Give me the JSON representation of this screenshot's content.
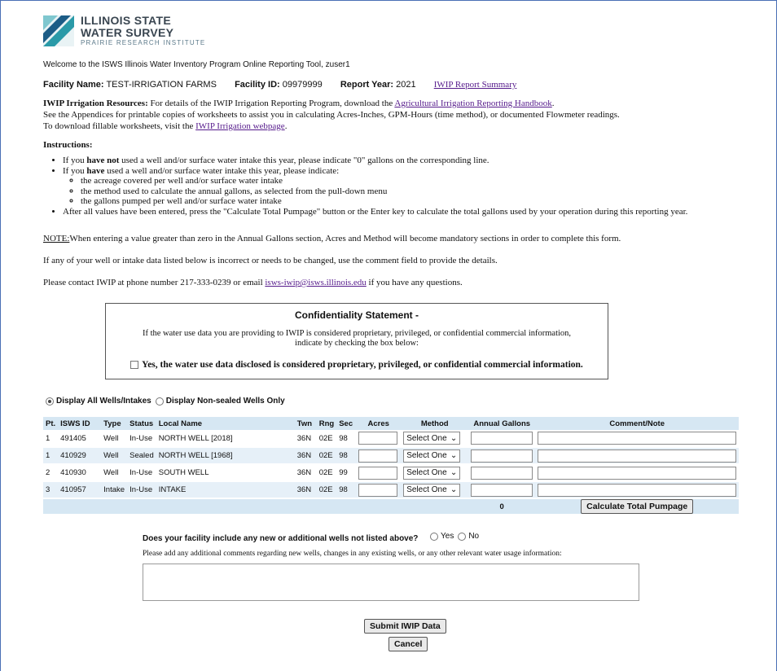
{
  "logo": {
    "line1": "ILLINOIS STATE",
    "line2": "WATER SURVEY",
    "line3": "PRAIRIE RESEARCH INSTITUTE"
  },
  "welcome": "Welcome to the ISWS Illinois Water Inventory Program Online Reporting Tool, zuser1",
  "facility": {
    "name_label": "Facility Name:",
    "name_value": "TEST-IRRIGATION FARMS",
    "id_label": "Facility ID:",
    "id_value": "09979999",
    "year_label": "Report Year:",
    "year_value": "2021",
    "summary_link": "IWIP Report Summary"
  },
  "resources": {
    "label": "IWIP Irrigation Resources:",
    "line1_text": " For details of the IWIP Irrigation Reporting Program, download the ",
    "handbook_link": "Agricultural Irrigation Reporting Handbook",
    "line1_end": ".",
    "line2": "See the Appendices for printable copies of worksheets to assist you in calculating Acres-Inches, GPM-Hours (time method), or documented Flowmeter readings.",
    "line3_text": "To download fillable worksheets, visit the ",
    "webpage_link": "IWIP Irrigation webpage",
    "line3_end": "."
  },
  "instructions": {
    "heading": "Instructions:",
    "b1_pre": "If you ",
    "b1_bold": "have not",
    "b1_post": " used a well and/or surface water intake this year, please indicate \"0\" gallons on the corresponding line.",
    "b2_pre": "If you ",
    "b2_bold": "have",
    "b2_post": " used a well and/or surface water intake this year, please indicate:",
    "sub1": "the acreage covered per well and/or surface water intake",
    "sub2": "the method used to calculate the annual gallons, as selected from the pull-down menu",
    "sub3": "the gallons pumped per well and/or surface water intake",
    "b3": "After all values have been entered, press the \"Calculate Total Pumpage\" button or the Enter key to calculate the total gallons used by your operation during this reporting year."
  },
  "note": {
    "label": "NOTE:",
    "text": "When entering a value greater than zero in the Annual Gallons section, Acres and Method will become mandatory sections in order to complete this form."
  },
  "incorrect": "If any of your well or intake data listed below is incorrect or needs to be changed, use the comment field to provide the details.",
  "contact": {
    "pre": "Please contact IWIP at phone number 217-333-0239 or email ",
    "email": "isws-iwip@isws.illinois.edu",
    "post": " if you have any questions."
  },
  "confidentiality": {
    "title": "Confidentiality Statement -",
    "line1": "If the water use data you are providing to IWIP is considered proprietary, privileged, or confidential commercial information,",
    "line2": "indicate by checking the box below:",
    "checkbox_label": "Yes, the water use data disclosed is considered proprietary, privileged, or confidential commercial information."
  },
  "display": {
    "all_label": "Display All Wells/Intakes",
    "nonsealed_label": "Display Non-sealed Wells Only"
  },
  "table": {
    "headers": {
      "pt": "Pt.",
      "isws": "ISWS ID",
      "type": "Type",
      "status": "Status",
      "local": "Local Name",
      "twn": "Twn",
      "rng": "Rng",
      "sec": "Sec",
      "acres": "Acres",
      "method": "Method",
      "gallons": "Annual Gallons",
      "comment": "Comment/Note"
    },
    "rows": [
      {
        "pt": "1",
        "isws": "491405",
        "type": "Well",
        "status": "In-Use",
        "local": "NORTH WELL [2018]",
        "twn": "36N",
        "rng": "02E",
        "sec": "98",
        "method": "Select One"
      },
      {
        "pt": "1",
        "isws": "410929",
        "type": "Well",
        "status": "Sealed",
        "local": "NORTH WELL [1968]",
        "twn": "36N",
        "rng": "02E",
        "sec": "98",
        "method": "Select One"
      },
      {
        "pt": "2",
        "isws": "410930",
        "type": "Well",
        "status": "In-Use",
        "local": "SOUTH WELL",
        "twn": "36N",
        "rng": "02E",
        "sec": "99",
        "method": "Select One"
      },
      {
        "pt": "3",
        "isws": "410957",
        "type": "Intake",
        "status": "In-Use",
        "local": "INTAKE",
        "twn": "36N",
        "rng": "02E",
        "sec": "98",
        "method": "Select One"
      }
    ],
    "total": "0",
    "calc_button": "Calculate Total Pumpage"
  },
  "new_wells": {
    "question": "Does your facility include any new or additional wells not listed above?",
    "yes": "Yes",
    "no": "No"
  },
  "additional_comments": "Please add any additional comments regarding new wells, changes in any existing wells, or any other relevant water usage information:",
  "buttons": {
    "submit": "Submit IWIP Data",
    "cancel": "Cancel"
  },
  "colors": {
    "header_bg": "#d6e7f3",
    "row_alt_bg": "#e6f0f8",
    "link": "#551a8b",
    "logo_teal": "#2a9aa8",
    "logo_blue": "#1c5c86"
  }
}
